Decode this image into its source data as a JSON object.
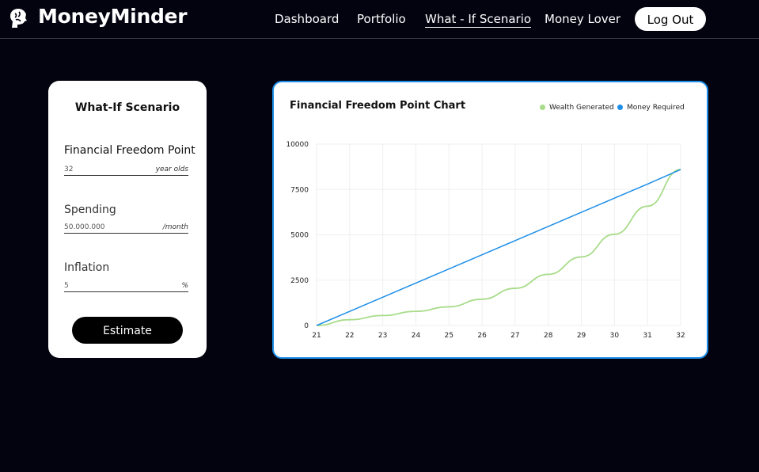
{
  "nav": {
    "brand": "MoneyMinder",
    "links": [
      "Dashboard",
      "Portfolio",
      "What - If Scenario",
      "Money Lover"
    ],
    "logout_label": "Log Out"
  },
  "scenario": {
    "title": "What-If Scenario",
    "fields": [
      {
        "label": "Financial Freedom Point",
        "value": "32",
        "unit": "year olds"
      },
      {
        "label": "Spending",
        "value": "50.000.000",
        "unit": "/month"
      },
      {
        "label": "Inflation",
        "value": "5",
        "unit": "%"
      }
    ],
    "estimate_label": "Estimate"
  },
  "colors": {
    "wealth": "#a8dc8a",
    "money": "#1e8fe8",
    "accent_border": "#1e8fe8"
  },
  "chart_data": {
    "type": "line",
    "title": "Financial Freedom Point Chart",
    "x": [
      21,
      22,
      23,
      24,
      25,
      26,
      27,
      28,
      29,
      30,
      31,
      32
    ],
    "ylim": [
      0,
      10000
    ],
    "yticks": [
      0,
      2500,
      5000,
      7500,
      10000
    ],
    "grid": true,
    "legend_position": "top-right",
    "series": [
      {
        "name": "Wealth Generated",
        "values": [
          0,
          320,
          550,
          780,
          1030,
          1450,
          2050,
          2820,
          3780,
          5030,
          6580,
          8600
        ]
      },
      {
        "name": "Money Required",
        "values": [
          0,
          780,
          1560,
          2340,
          3120,
          3900,
          4680,
          5460,
          6240,
          7020,
          7800,
          8600
        ]
      }
    ]
  }
}
